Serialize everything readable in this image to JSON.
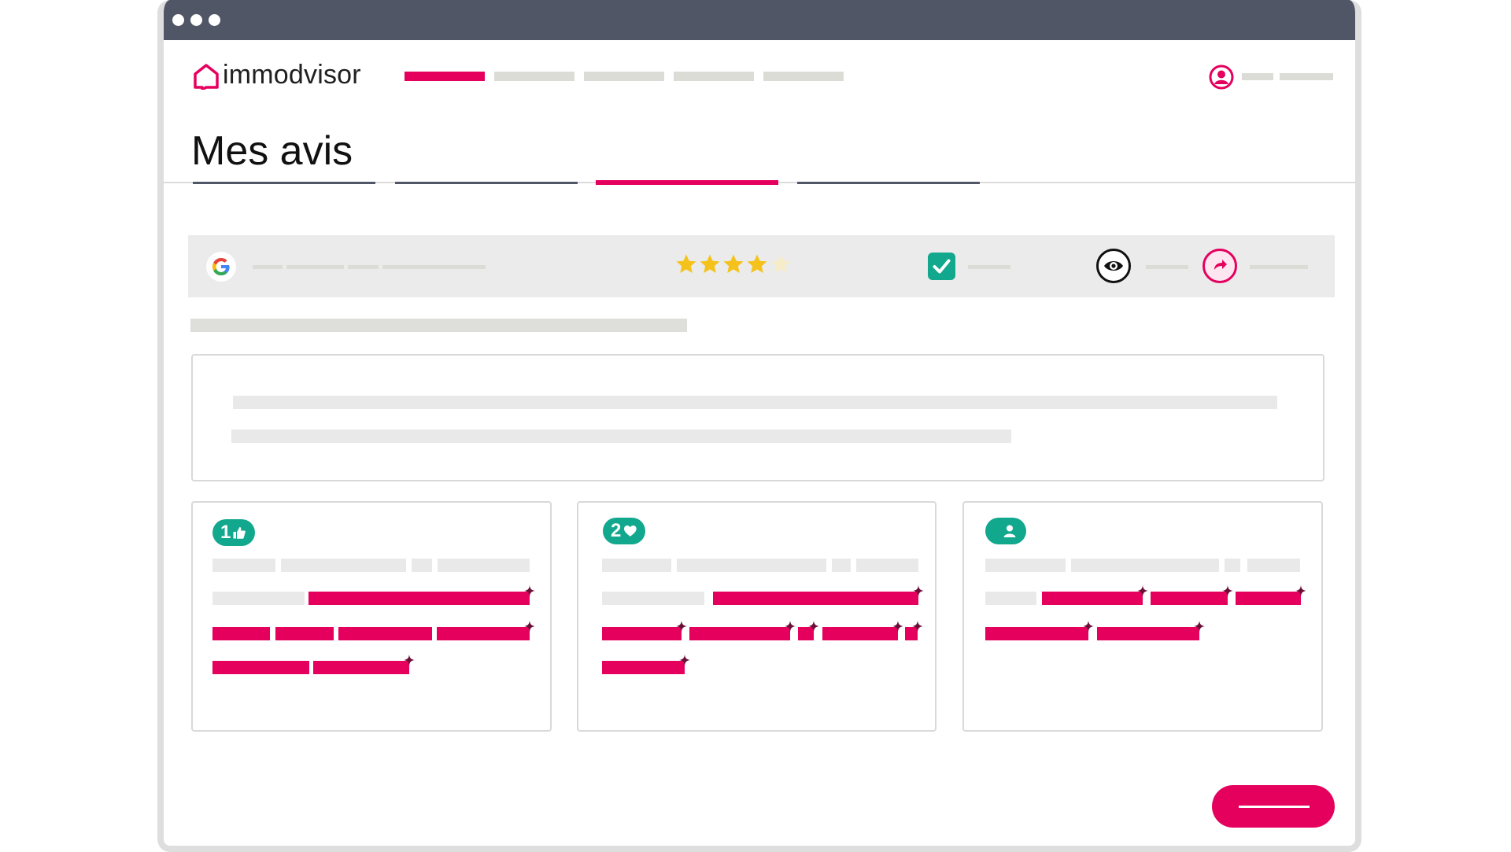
{
  "app": {
    "logo_text": "immodvisor"
  },
  "page": {
    "title": "Mes avis"
  },
  "cards": [
    {
      "badge": "1",
      "badge_icon": "thumbs-up-icon"
    },
    {
      "badge": "2",
      "badge_icon": "heart-icon"
    },
    {
      "badge": "",
      "badge_icon": "user-icon"
    }
  ],
  "review": {
    "rating": 4,
    "rating_max": 5,
    "source_icon": "google-logo-icon"
  },
  "colors": {
    "brand": "#e5005e",
    "accent": "#12a88e",
    "dark": "#505666",
    "star": "#f5c21b"
  }
}
